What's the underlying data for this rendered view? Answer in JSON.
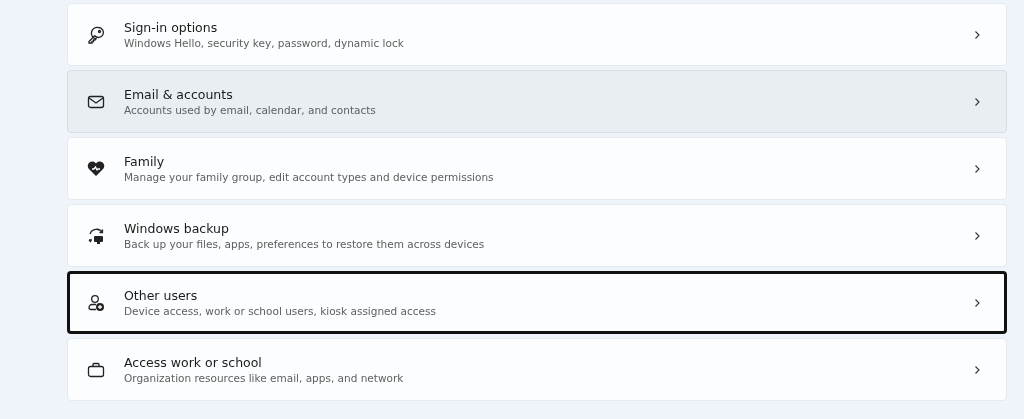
{
  "items": [
    {
      "kind": "key",
      "title": "Sign-in options",
      "subtitle": "Windows Hello, security key, password, dynamic lock",
      "hovered": false,
      "highlighted": false
    },
    {
      "kind": "mail",
      "title": "Email & accounts",
      "subtitle": "Accounts used by email, calendar, and contacts",
      "hovered": true,
      "highlighted": false
    },
    {
      "kind": "heart",
      "title": "Family",
      "subtitle": "Manage your family group, edit account types and device permissions",
      "hovered": false,
      "highlighted": false
    },
    {
      "kind": "backup",
      "title": "Windows backup",
      "subtitle": "Back up your files, apps, preferences to restore them across devices",
      "hovered": false,
      "highlighted": false
    },
    {
      "kind": "user-add",
      "title": "Other users",
      "subtitle": "Device access, work or school users, kiosk assigned access",
      "hovered": false,
      "highlighted": true
    },
    {
      "kind": "briefcase",
      "title": "Access work or school",
      "subtitle": "Organization resources like email, apps, and network",
      "hovered": false,
      "highlighted": false
    }
  ]
}
